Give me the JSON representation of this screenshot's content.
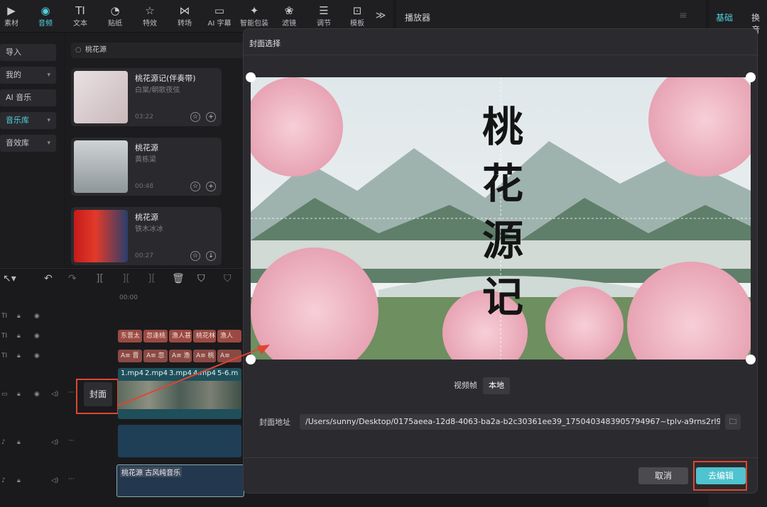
{
  "toolbar": {
    "items": [
      {
        "label": "素材",
        "icon": "media-icon"
      },
      {
        "label": "音频",
        "icon": "audio-icon"
      },
      {
        "label": "文本",
        "icon": "text-icon"
      },
      {
        "label": "贴纸",
        "icon": "sticker-icon"
      },
      {
        "label": "特效",
        "icon": "effect-icon"
      },
      {
        "label": "转场",
        "icon": "transition-icon"
      },
      {
        "label": "AI 字幕",
        "icon": "caption-icon"
      },
      {
        "label": "智能包装",
        "icon": "smart-pack-icon"
      },
      {
        "label": "滤镜",
        "icon": "filter-icon"
      },
      {
        "label": "调节",
        "icon": "adjust-icon"
      },
      {
        "label": "模板",
        "icon": "template-icon"
      }
    ],
    "more": "≫"
  },
  "nav": {
    "import": "导入",
    "mine": "我的",
    "ai_music": "AI 音乐",
    "music_lib": "音乐库",
    "sfx_lib": "音效库"
  },
  "library": {
    "search_value": "桃花源",
    "songs": [
      {
        "title": "桃花源记(伴奏带)",
        "artist": "白棠/朝歌夜弦",
        "duration": "03:22"
      },
      {
        "title": "桃花源",
        "artist": "黄栋梁",
        "duration": "00:48"
      },
      {
        "title": "桃花源",
        "artist": "铁木冰冰",
        "duration": "00:27"
      }
    ]
  },
  "player": {
    "title": "播放器"
  },
  "right_panel": {
    "tab_basic": "基础",
    "tab_swap": "换音"
  },
  "timeline": {
    "time_start": "00:00",
    "text_clips": [
      "东晋太",
      "忽逢桃",
      "渔人甚",
      "桃花林",
      "渔人"
    ],
    "sub_clips": [
      "A≡ 晋",
      "A≡ 忽",
      "A≡ 渔",
      "A≡ 桃",
      "A≡"
    ],
    "video_clips": [
      "1.mp4",
      "2.mp4",
      "3.mp4",
      "4.mp4",
      "5-6.m"
    ],
    "cover_label": "封面",
    "audio_clip": "桃花源 古风纯音乐"
  },
  "modal": {
    "title": "封面选择",
    "tab_video_frame": "视频帧",
    "tab_local": "本地",
    "path_label": "封面地址",
    "path_value": "/Users/sunny/Desktop/0175aeea-12d8-4063-ba2a-b2c30361ee39_1750403483905794967~tplv-a9rns2rl9...",
    "cancel": "取消",
    "go_edit": "去编辑",
    "cover_calligraphy": [
      "桃",
      "花",
      "源",
      "记"
    ]
  },
  "colors": {
    "accent": "#4fd1d9",
    "highlight": "#e0452f",
    "primary_button": "#4fc3cf"
  }
}
